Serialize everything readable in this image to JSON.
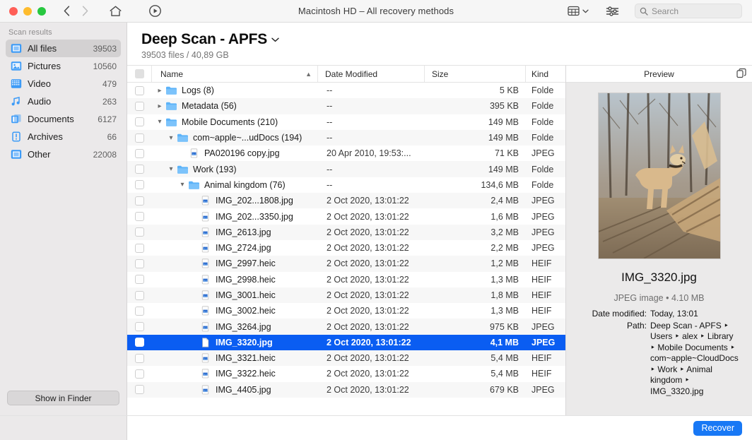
{
  "window": {
    "title": "Macintosh HD – All recovery methods",
    "traffic_lights": [
      "close",
      "minimize",
      "zoom"
    ],
    "nav_back": "back-chevron",
    "nav_forward": "forward-chevron",
    "home_icon": "home-icon",
    "rescan_icon": "play-circle-icon",
    "viewmode_icon": "grid-view-icon",
    "viewmode_chevron": "chevron-down-icon",
    "filter_icon": "sliders-icon",
    "search_icon": "search-icon",
    "search_placeholder": "Search",
    "search_value": ""
  },
  "sidebar": {
    "header": "Scan results",
    "items": [
      {
        "label": "All files",
        "count": "39503",
        "icon": "all-files-icon",
        "active": true
      },
      {
        "label": "Pictures",
        "count": "10560",
        "icon": "pictures-icon",
        "active": false
      },
      {
        "label": "Video",
        "count": "479",
        "icon": "video-icon",
        "active": false
      },
      {
        "label": "Audio",
        "count": "263",
        "icon": "audio-icon",
        "active": false
      },
      {
        "label": "Documents",
        "count": "6127",
        "icon": "documents-icon",
        "active": false
      },
      {
        "label": "Archives",
        "count": "66",
        "icon": "archives-icon",
        "active": false
      },
      {
        "label": "Other",
        "count": "22008",
        "icon": "other-icon",
        "active": false
      }
    ],
    "show_in_finder": "Show in Finder"
  },
  "main": {
    "scan_title": "Deep Scan - APFS",
    "scan_title_chevron": "chevron-down-icon",
    "scan_subtitle": "39503 files / 40,89 GB"
  },
  "columns": {
    "name": "Name",
    "sort_caret": "sort-ascending-caret",
    "date_modified": "Date Modified",
    "size": "Size",
    "kind": "Kind"
  },
  "rows": [
    {
      "name": "Logs (8)",
      "date": "--",
      "size": "5 KB",
      "kind": "Folde",
      "indent": 1,
      "twisty": "collapsed",
      "icon": "folder-icon",
      "selected": false
    },
    {
      "name": "Metadata (56)",
      "date": "--",
      "size": "395 KB",
      "kind": "Folde",
      "indent": 1,
      "twisty": "collapsed",
      "icon": "folder-icon",
      "selected": false
    },
    {
      "name": "Mobile Documents (210)",
      "date": "--",
      "size": "149 MB",
      "kind": "Folde",
      "indent": 1,
      "twisty": "expanded",
      "icon": "folder-icon",
      "selected": false
    },
    {
      "name": "com~apple~...udDocs (194)",
      "date": "--",
      "size": "149 MB",
      "kind": "Folde",
      "indent": 2,
      "twisty": "expanded",
      "icon": "folder-icon",
      "selected": false
    },
    {
      "name": "PA020196 copy.jpg",
      "date": "20 Apr 2010, 19:53:...",
      "size": "71 KB",
      "kind": "JPEG",
      "indent": 3,
      "twisty": "none",
      "icon": "image-file-icon",
      "selected": false
    },
    {
      "name": "Work (193)",
      "date": "--",
      "size": "149 MB",
      "kind": "Folde",
      "indent": 2,
      "twisty": "expanded",
      "icon": "folder-icon",
      "selected": false
    },
    {
      "name": "Animal kingdom (76)",
      "date": "--",
      "size": "134,6 MB",
      "kind": "Folde",
      "indent": 3,
      "twisty": "expanded",
      "icon": "folder-icon",
      "selected": false
    },
    {
      "name": "IMG_202...1808.jpg",
      "date": "2 Oct 2020, 13:01:22",
      "size": "2,4 MB",
      "kind": "JPEG",
      "indent": 4,
      "twisty": "none",
      "icon": "image-file-icon",
      "selected": false
    },
    {
      "name": "IMG_202...3350.jpg",
      "date": "2 Oct 2020, 13:01:22",
      "size": "1,6 MB",
      "kind": "JPEG",
      "indent": 4,
      "twisty": "none",
      "icon": "image-file-icon",
      "selected": false
    },
    {
      "name": "IMG_2613.jpg",
      "date": "2 Oct 2020, 13:01:22",
      "size": "3,2 MB",
      "kind": "JPEG",
      "indent": 4,
      "twisty": "none",
      "icon": "image-file-icon",
      "selected": false
    },
    {
      "name": "IMG_2724.jpg",
      "date": "2 Oct 2020, 13:01:22",
      "size": "2,2 MB",
      "kind": "JPEG",
      "indent": 4,
      "twisty": "none",
      "icon": "image-file-icon",
      "selected": false
    },
    {
      "name": "IMG_2997.heic",
      "date": "2 Oct 2020, 13:01:22",
      "size": "1,2 MB",
      "kind": "HEIF",
      "indent": 4,
      "twisty": "none",
      "icon": "image-file-icon",
      "selected": false
    },
    {
      "name": "IMG_2998.heic",
      "date": "2 Oct 2020, 13:01:22",
      "size": "1,3 MB",
      "kind": "HEIF",
      "indent": 4,
      "twisty": "none",
      "icon": "image-file-icon",
      "selected": false
    },
    {
      "name": "IMG_3001.heic",
      "date": "2 Oct 2020, 13:01:22",
      "size": "1,8 MB",
      "kind": "HEIF",
      "indent": 4,
      "twisty": "none",
      "icon": "image-file-icon",
      "selected": false
    },
    {
      "name": "IMG_3002.heic",
      "date": "2 Oct 2020, 13:01:22",
      "size": "1,3 MB",
      "kind": "HEIF",
      "indent": 4,
      "twisty": "none",
      "icon": "image-file-icon",
      "selected": false
    },
    {
      "name": "IMG_3264.jpg",
      "date": "2 Oct 2020, 13:01:22",
      "size": "975 KB",
      "kind": "JPEG",
      "indent": 4,
      "twisty": "none",
      "icon": "image-file-icon",
      "selected": false
    },
    {
      "name": "IMG_3320.jpg",
      "date": "2 Oct 2020, 13:01:22",
      "size": "4,1 MB",
      "kind": "JPEG",
      "indent": 4,
      "twisty": "none",
      "icon": "document-file-icon",
      "selected": true
    },
    {
      "name": "IMG_3321.heic",
      "date": "2 Oct 2020, 13:01:22",
      "size": "5,4 MB",
      "kind": "HEIF",
      "indent": 4,
      "twisty": "none",
      "icon": "image-file-icon",
      "selected": false
    },
    {
      "name": "IMG_3322.heic",
      "date": "2 Oct 2020, 13:01:22",
      "size": "5,4 MB",
      "kind": "HEIF",
      "indent": 4,
      "twisty": "none",
      "icon": "image-file-icon",
      "selected": false
    },
    {
      "name": "IMG_4405.jpg",
      "date": "2 Oct 2020, 13:01:22",
      "size": "679 KB",
      "kind": "JPEG",
      "indent": 4,
      "twisty": "none",
      "icon": "image-file-icon",
      "selected": false
    }
  ],
  "preview": {
    "header": "Preview",
    "copy_icon": "copy-icon",
    "thumbnail_alt": "dog standing on fallen tree in winter forest",
    "file_name": "IMG_3320.jpg",
    "file_type_size": "JPEG image • 4.10 MB",
    "date_modified_label": "Date modified:",
    "date_modified_value": "Today, 13:01",
    "path_label": "Path:",
    "path_value": "Deep Scan - APFS ‣ Users ‣ alex ‣ Library ‣ Mobile Documents ‣ com~apple~CloudDocs ‣ Work ‣ Animal kingdom ‣ IMG_3320.jpg"
  },
  "footer": {
    "recover_label": "Recover"
  },
  "colors": {
    "accent_blue": "#1878f5",
    "selection_blue": "#0a5df2",
    "icon_blue": "#3d9bf7",
    "sidebar_bg": "#ebe9ea",
    "preview_bg": "#ebeaea"
  }
}
